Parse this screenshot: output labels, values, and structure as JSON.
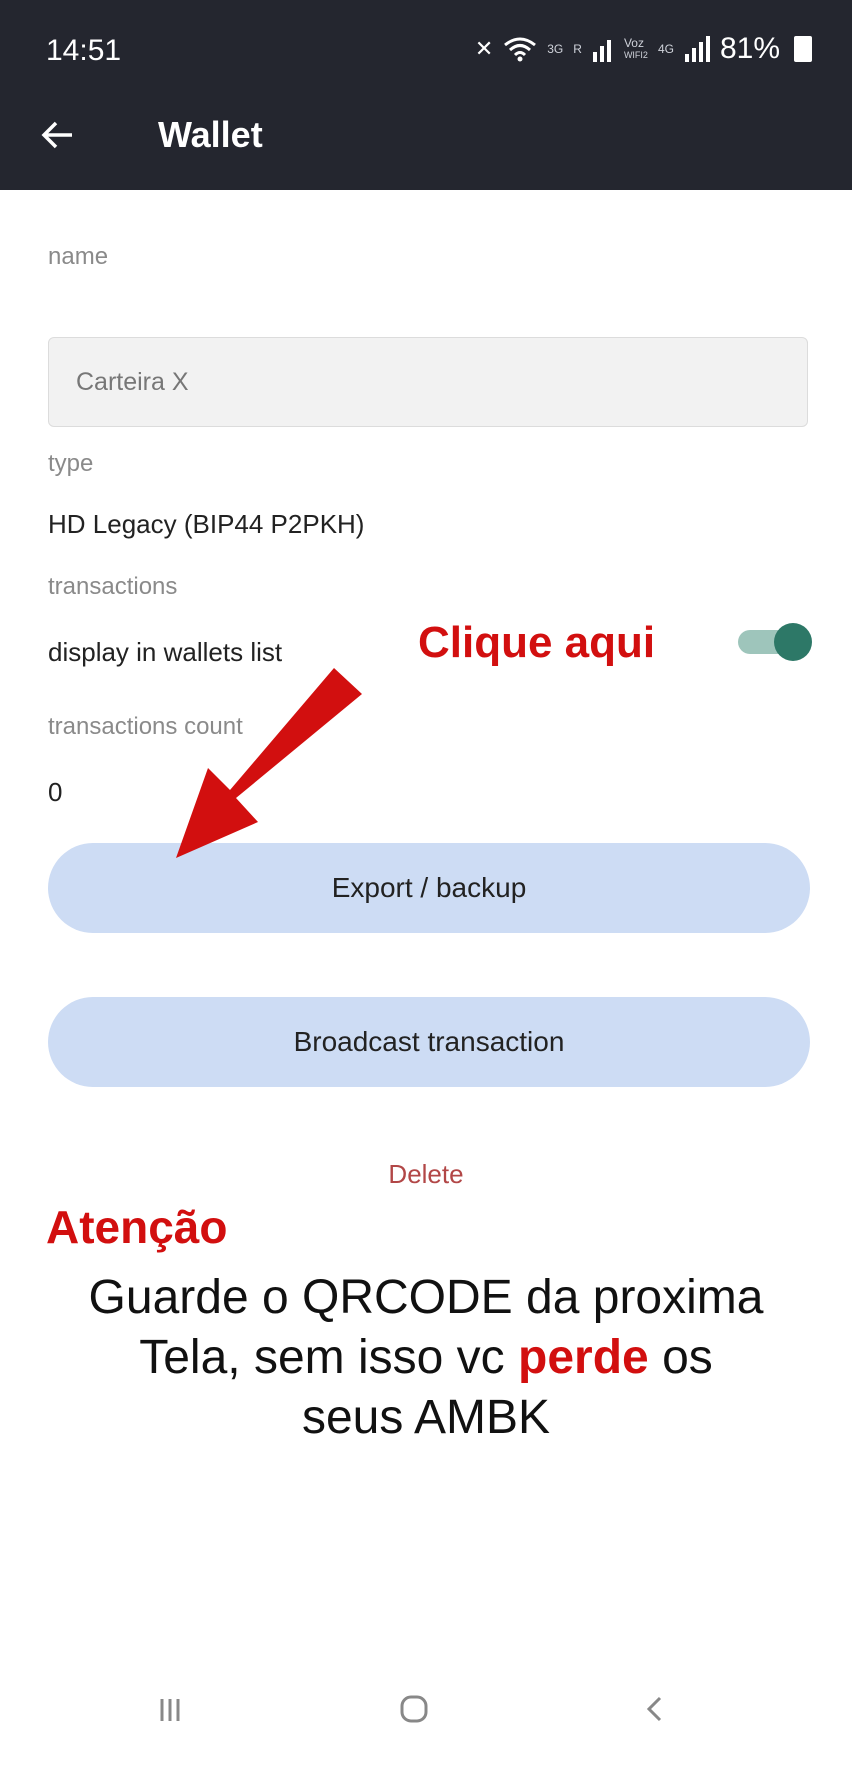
{
  "status_bar": {
    "time": "14:51",
    "network_3g": "3G",
    "network_4g": "4G",
    "carrier_r": "R",
    "voz_label": "Voz",
    "wifi_label": "WIFI2",
    "battery": "81%"
  },
  "app_bar": {
    "title": "Wallet",
    "back_icon": "arrow-left-icon"
  },
  "form": {
    "name_label": "name",
    "name_value": "Carteira X",
    "type_label": "type",
    "type_value": "HD Legacy (BIP44 P2PKH)",
    "transactions_label": "transactions",
    "display_label": "display in wallets list",
    "display_enabled": true,
    "count_label": "transactions count",
    "count_value": "0"
  },
  "actions": {
    "export_label": "Export / backup",
    "broadcast_label": "Broadcast transaction",
    "delete_label": "Delete"
  },
  "annotations": {
    "click_here": "Clique aqui",
    "attention": "Atenção",
    "warning_line1": "Guarde o QRCODE da proxima",
    "warning_line2_start": "Tela, sem isso vc ",
    "warning_line2_highlight": "perde",
    "warning_line2_end": " os",
    "warning_line3": "seus AMBK"
  },
  "colors": {
    "header_bg": "#24262f",
    "button_bg": "#cddcf4",
    "toggle_on": "#2d7867",
    "delete_text": "#b24747",
    "annotation_red": "#d20f0f"
  },
  "nav_bar": {
    "recents_icon": "recents-icon",
    "home_icon": "home-icon",
    "back_icon": "back-icon"
  }
}
